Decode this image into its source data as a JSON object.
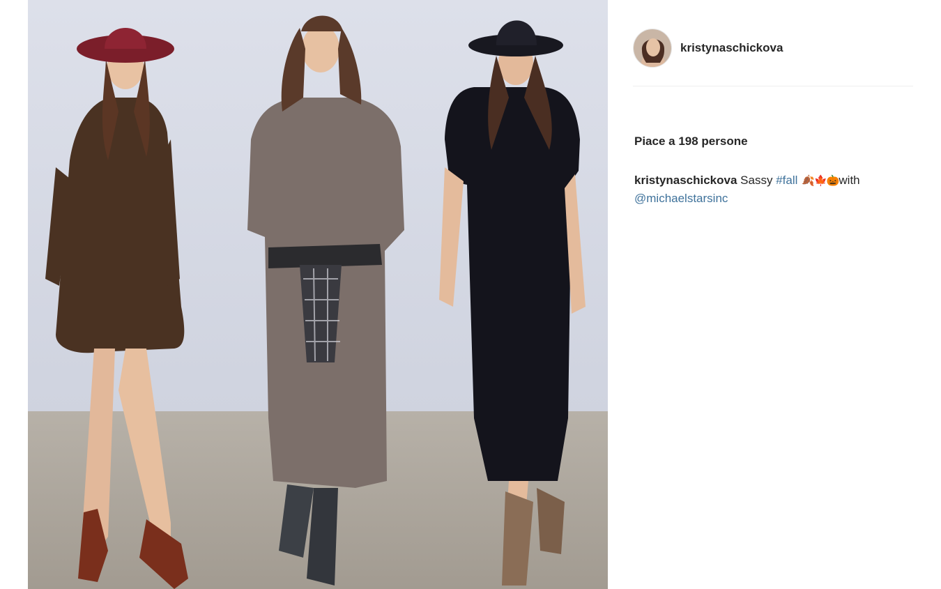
{
  "post": {
    "photo_alt": "",
    "username": "kristynaschickova",
    "likes_text": "Piace a 198 persone",
    "caption": {
      "username": "kristynaschickova",
      "text_before": "Sassy",
      "hashtag": "#fall",
      "emoji": "🍂🍁🎃",
      "text_after": "with",
      "mention": "@michaelstarsinc"
    }
  },
  "colors": {
    "link": "#3f729b",
    "text": "#262626",
    "divider": "#efefef"
  },
  "icons": {
    "avatar": "profile-photo",
    "emoji": [
      "leaf-icon",
      "maple-leaf-icon",
      "pumpkin-icon"
    ]
  }
}
